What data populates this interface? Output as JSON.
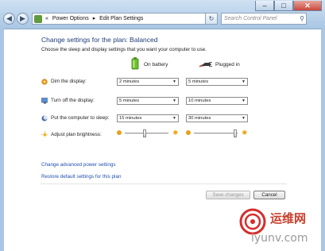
{
  "window": {
    "back_icon": "back-arrow-icon",
    "forward_icon": "forward-arrow-icon",
    "minimize_label": "–",
    "maximize_label": "□",
    "close_label": "✕"
  },
  "address": {
    "sep1": "«",
    "crumb1": "Power Options",
    "sep2": "▸",
    "crumb2": "Edit Plan Settings",
    "refresh": "↻",
    "dropdown": "▾"
  },
  "search": {
    "placeholder": "Search Control Panel"
  },
  "page": {
    "heading": "Change settings for the plan: Balanced",
    "subheading": "Choose the sleep and display settings that you want your computer to use.",
    "col_battery": "On battery",
    "col_plugged": "Plugged in"
  },
  "rows": [
    {
      "label": "Dim the display:",
      "battery": "2 minutes",
      "plugged": "5 minutes"
    },
    {
      "label": "Turn off the display:",
      "battery": "5 minutes",
      "plugged": "10 minutes"
    },
    {
      "label": "Put the computer to sleep:",
      "battery": "15 minutes",
      "plugged": "30 minutes"
    }
  ],
  "brightness": {
    "label": "Adjust plan brightness:",
    "battery_level": 0.45,
    "plugged_level": 0.95
  },
  "links": {
    "advanced": "Change advanced power settings",
    "restore": "Restore default settings for this plan"
  },
  "buttons": {
    "save": "Save changes",
    "cancel": "Cancel"
  },
  "watermark": {
    "text_cn": "运维网",
    "text_url": "iyunv.com"
  },
  "colors": {
    "heading": "#1e3e7a",
    "link": "#1f4fb0",
    "titlebar": "#b8d1ea",
    "watermark_red": "#d62d2d"
  }
}
